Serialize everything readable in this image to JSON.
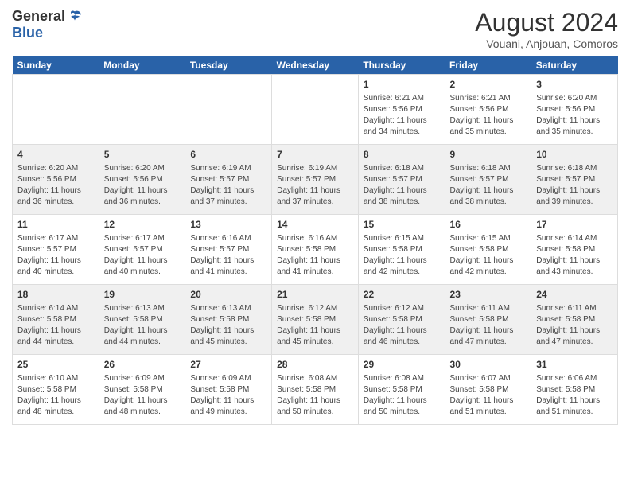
{
  "logo": {
    "general": "General",
    "blue": "Blue"
  },
  "title": "August 2024",
  "subtitle": "Vouani, Anjouan, Comoros",
  "days": [
    "Sunday",
    "Monday",
    "Tuesday",
    "Wednesday",
    "Thursday",
    "Friday",
    "Saturday"
  ],
  "weeks": [
    [
      {
        "day": "",
        "text": ""
      },
      {
        "day": "",
        "text": ""
      },
      {
        "day": "",
        "text": ""
      },
      {
        "day": "",
        "text": ""
      },
      {
        "day": "1",
        "text": "Sunrise: 6:21 AM\nSunset: 5:56 PM\nDaylight: 11 hours\nand 34 minutes."
      },
      {
        "day": "2",
        "text": "Sunrise: 6:21 AM\nSunset: 5:56 PM\nDaylight: 11 hours\nand 35 minutes."
      },
      {
        "day": "3",
        "text": "Sunrise: 6:20 AM\nSunset: 5:56 PM\nDaylight: 11 hours\nand 35 minutes."
      }
    ],
    [
      {
        "day": "4",
        "text": "Sunrise: 6:20 AM\nSunset: 5:56 PM\nDaylight: 11 hours\nand 36 minutes."
      },
      {
        "day": "5",
        "text": "Sunrise: 6:20 AM\nSunset: 5:56 PM\nDaylight: 11 hours\nand 36 minutes."
      },
      {
        "day": "6",
        "text": "Sunrise: 6:19 AM\nSunset: 5:57 PM\nDaylight: 11 hours\nand 37 minutes."
      },
      {
        "day": "7",
        "text": "Sunrise: 6:19 AM\nSunset: 5:57 PM\nDaylight: 11 hours\nand 37 minutes."
      },
      {
        "day": "8",
        "text": "Sunrise: 6:18 AM\nSunset: 5:57 PM\nDaylight: 11 hours\nand 38 minutes."
      },
      {
        "day": "9",
        "text": "Sunrise: 6:18 AM\nSunset: 5:57 PM\nDaylight: 11 hours\nand 38 minutes."
      },
      {
        "day": "10",
        "text": "Sunrise: 6:18 AM\nSunset: 5:57 PM\nDaylight: 11 hours\nand 39 minutes."
      }
    ],
    [
      {
        "day": "11",
        "text": "Sunrise: 6:17 AM\nSunset: 5:57 PM\nDaylight: 11 hours\nand 40 minutes."
      },
      {
        "day": "12",
        "text": "Sunrise: 6:17 AM\nSunset: 5:57 PM\nDaylight: 11 hours\nand 40 minutes."
      },
      {
        "day": "13",
        "text": "Sunrise: 6:16 AM\nSunset: 5:57 PM\nDaylight: 11 hours\nand 41 minutes."
      },
      {
        "day": "14",
        "text": "Sunrise: 6:16 AM\nSunset: 5:58 PM\nDaylight: 11 hours\nand 41 minutes."
      },
      {
        "day": "15",
        "text": "Sunrise: 6:15 AM\nSunset: 5:58 PM\nDaylight: 11 hours\nand 42 minutes."
      },
      {
        "day": "16",
        "text": "Sunrise: 6:15 AM\nSunset: 5:58 PM\nDaylight: 11 hours\nand 42 minutes."
      },
      {
        "day": "17",
        "text": "Sunrise: 6:14 AM\nSunset: 5:58 PM\nDaylight: 11 hours\nand 43 minutes."
      }
    ],
    [
      {
        "day": "18",
        "text": "Sunrise: 6:14 AM\nSunset: 5:58 PM\nDaylight: 11 hours\nand 44 minutes."
      },
      {
        "day": "19",
        "text": "Sunrise: 6:13 AM\nSunset: 5:58 PM\nDaylight: 11 hours\nand 44 minutes."
      },
      {
        "day": "20",
        "text": "Sunrise: 6:13 AM\nSunset: 5:58 PM\nDaylight: 11 hours\nand 45 minutes."
      },
      {
        "day": "21",
        "text": "Sunrise: 6:12 AM\nSunset: 5:58 PM\nDaylight: 11 hours\nand 45 minutes."
      },
      {
        "day": "22",
        "text": "Sunrise: 6:12 AM\nSunset: 5:58 PM\nDaylight: 11 hours\nand 46 minutes."
      },
      {
        "day": "23",
        "text": "Sunrise: 6:11 AM\nSunset: 5:58 PM\nDaylight: 11 hours\nand 47 minutes."
      },
      {
        "day": "24",
        "text": "Sunrise: 6:11 AM\nSunset: 5:58 PM\nDaylight: 11 hours\nand 47 minutes."
      }
    ],
    [
      {
        "day": "25",
        "text": "Sunrise: 6:10 AM\nSunset: 5:58 PM\nDaylight: 11 hours\nand 48 minutes."
      },
      {
        "day": "26",
        "text": "Sunrise: 6:09 AM\nSunset: 5:58 PM\nDaylight: 11 hours\nand 48 minutes."
      },
      {
        "day": "27",
        "text": "Sunrise: 6:09 AM\nSunset: 5:58 PM\nDaylight: 11 hours\nand 49 minutes."
      },
      {
        "day": "28",
        "text": "Sunrise: 6:08 AM\nSunset: 5:58 PM\nDaylight: 11 hours\nand 50 minutes."
      },
      {
        "day": "29",
        "text": "Sunrise: 6:08 AM\nSunset: 5:58 PM\nDaylight: 11 hours\nand 50 minutes."
      },
      {
        "day": "30",
        "text": "Sunrise: 6:07 AM\nSunset: 5:58 PM\nDaylight: 11 hours\nand 51 minutes."
      },
      {
        "day": "31",
        "text": "Sunrise: 6:06 AM\nSunset: 5:58 PM\nDaylight: 11 hours\nand 51 minutes."
      }
    ]
  ]
}
